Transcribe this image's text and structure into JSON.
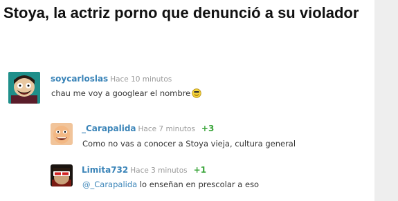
{
  "article": {
    "title": "Stoya, la actriz porno que denunció a su violador"
  },
  "comments": [
    {
      "username": "soycarloslas",
      "time": "Hace 10 minutos",
      "votes": "",
      "text": "chau me voy a googlear el nombre",
      "emoji_icon": "smiley-icon",
      "avatar_icon": "south-park-avatar-icon"
    },
    {
      "username": "_Carapalida",
      "time": "Hace 7 minutos",
      "votes": "+3",
      "text": "Como no vas a conocer a Stoya vieja, cultura general",
      "avatar_icon": "cartoon-face-avatar-icon"
    },
    {
      "username": "Limita732",
      "time": "Hace 3 minutos",
      "votes": "+1",
      "mention": "@_Carapalida",
      "text": " lo enseñan en prescolar a eso",
      "avatar_icon": "3d-glasses-avatar-icon"
    }
  ],
  "colors": {
    "username": "#3a84b8",
    "votes": "#3aa53a",
    "time": "#9a9a9a",
    "sidebar": "#eeeeee"
  }
}
